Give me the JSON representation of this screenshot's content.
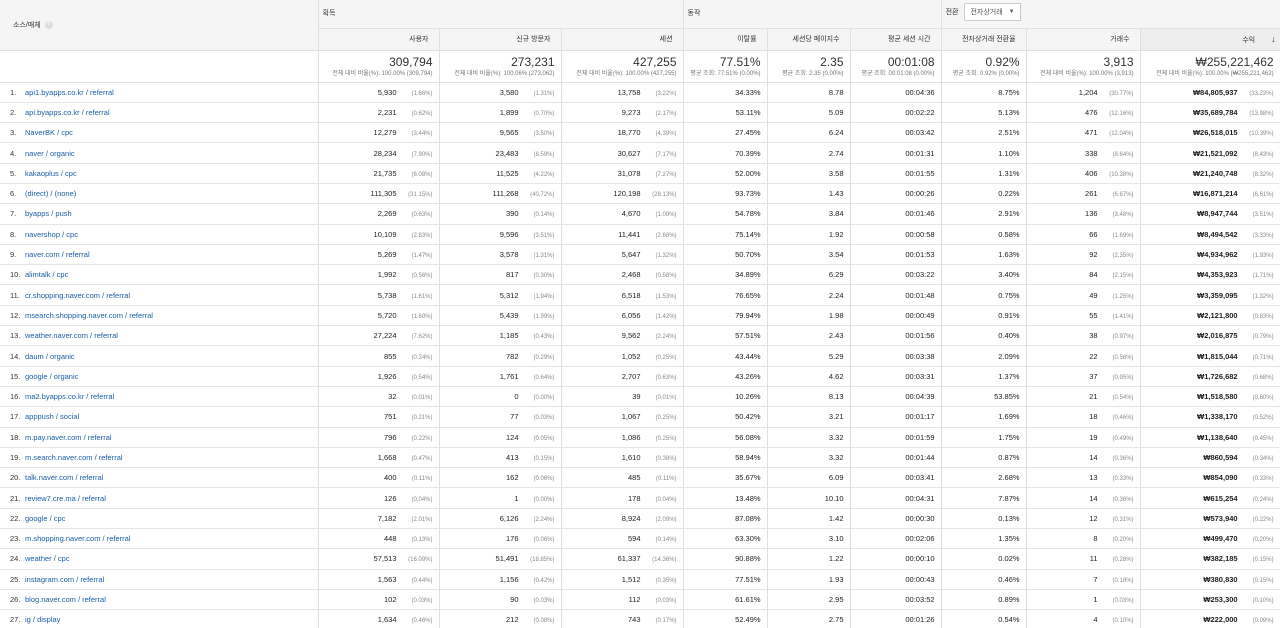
{
  "header": {
    "dimension_label": "소스/매체",
    "help_glyph": "?",
    "groups": {
      "acquisition": "획득",
      "behavior": "동작",
      "conversion": "전환"
    },
    "conversion_select": "전자상거래",
    "columns": [
      "사용자",
      "신규 방문자",
      "세션",
      "이탈률",
      "세션당 페이지수",
      "평균 세션 시간",
      "전자상거래 전환율",
      "거래수",
      "수익"
    ]
  },
  "totals": [
    {
      "value": "309,794",
      "sub": "전체 대비 비율(%): 100.00% (309,794)"
    },
    {
      "value": "273,231",
      "sub": "전체 대비 비율(%): 100.06% (273,062)"
    },
    {
      "value": "427,255",
      "sub": "전체 대비 비율(%): 100.00% (427,255)"
    },
    {
      "value": "77.51%",
      "sub": "평균 조회: 77.51% (0.00%)"
    },
    {
      "value": "2.35",
      "sub": "평균 조회: 2.35 (0.00%)"
    },
    {
      "value": "00:01:08",
      "sub": "평균 조회: 00:01:08 (0.00%)"
    },
    {
      "value": "0.92%",
      "sub": "평균 조회: 0.92% (0.00%)"
    },
    {
      "value": "3,913",
      "sub": "전체 대비 비율(%): 100.00% (3,913)"
    },
    {
      "value": "₩255,221,462",
      "sub": "전체 대비 비율(%): 100.00% (₩255,221,462)"
    }
  ],
  "rows": [
    {
      "idx": "1.",
      "source": "api1.byapps.co.kr / referral",
      "users": "5,930",
      "users_pct": "(1.66%)",
      "new_users": "3,580",
      "new_users_pct": "(1.31%)",
      "sessions": "13,758",
      "sessions_pct": "(3.22%)",
      "bounce": "34.33%",
      "pps": "8.78",
      "duration": "00:04:36",
      "conv": "8.75%",
      "trans": "1,204",
      "trans_pct": "(30.77%)",
      "revenue": "₩84,805,937",
      "revenue_pct": "(33.23%)"
    },
    {
      "idx": "2.",
      "source": "api.byapps.co.kr / referral",
      "users": "2,231",
      "users_pct": "(0.62%)",
      "new_users": "1,899",
      "new_users_pct": "(0.70%)",
      "sessions": "9,273",
      "sessions_pct": "(2.17%)",
      "bounce": "53.11%",
      "pps": "5.09",
      "duration": "00:02:22",
      "conv": "5.13%",
      "trans": "476",
      "trans_pct": "(12.16%)",
      "revenue": "₩35,689,784",
      "revenue_pct": "(13.98%)"
    },
    {
      "idx": "3.",
      "source": "NaverBK / cpc",
      "users": "12,279",
      "users_pct": "(3.44%)",
      "new_users": "9,565",
      "new_users_pct": "(3.50%)",
      "sessions": "18,770",
      "sessions_pct": "(4.39%)",
      "bounce": "27.45%",
      "pps": "6.24",
      "duration": "00:03:42",
      "conv": "2.51%",
      "trans": "471",
      "trans_pct": "(12.04%)",
      "revenue": "₩26,518,015",
      "revenue_pct": "(10.39%)"
    },
    {
      "idx": "4.",
      "source": "naver / organic",
      "users": "28,234",
      "users_pct": "(7.90%)",
      "new_users": "23,483",
      "new_users_pct": "(8.59%)",
      "sessions": "30,627",
      "sessions_pct": "(7.17%)",
      "bounce": "70.39%",
      "pps": "2.74",
      "duration": "00:01:31",
      "conv": "1.10%",
      "trans": "338",
      "trans_pct": "(8.64%)",
      "revenue": "₩21,521,092",
      "revenue_pct": "(8.43%)"
    },
    {
      "idx": "5.",
      "source": "kakaoplus / cpc",
      "users": "21,735",
      "users_pct": "(6.08%)",
      "new_users": "11,525",
      "new_users_pct": "(4.22%)",
      "sessions": "31,078",
      "sessions_pct": "(7.27%)",
      "bounce": "52.00%",
      "pps": "3.58",
      "duration": "00:01:55",
      "conv": "1.31%",
      "trans": "406",
      "trans_pct": "(10.38%)",
      "revenue": "₩21,240,748",
      "revenue_pct": "(8.32%)"
    },
    {
      "idx": "6.",
      "source": "(direct) / (none)",
      "users": "111,305",
      "users_pct": "(31.15%)",
      "new_users": "111,268",
      "new_users_pct": "(40.72%)",
      "sessions": "120,198",
      "sessions_pct": "(28.13%)",
      "bounce": "93.73%",
      "pps": "1.43",
      "duration": "00:00:26",
      "conv": "0.22%",
      "trans": "261",
      "trans_pct": "(6.67%)",
      "revenue": "₩16,871,214",
      "revenue_pct": "(6.61%)"
    },
    {
      "idx": "7.",
      "source": "byapps / push",
      "users": "2,269",
      "users_pct": "(0.63%)",
      "new_users": "390",
      "new_users_pct": "(0.14%)",
      "sessions": "4,670",
      "sessions_pct": "(1.09%)",
      "bounce": "54.78%",
      "pps": "3.84",
      "duration": "00:01:46",
      "conv": "2.91%",
      "trans": "136",
      "trans_pct": "(3.48%)",
      "revenue": "₩8,947,744",
      "revenue_pct": "(3.51%)"
    },
    {
      "idx": "8.",
      "source": "navershop / cpc",
      "users": "10,109",
      "users_pct": "(2.83%)",
      "new_users": "9,596",
      "new_users_pct": "(3.51%)",
      "sessions": "11,441",
      "sessions_pct": "(2.68%)",
      "bounce": "75.14%",
      "pps": "1.92",
      "duration": "00:00:58",
      "conv": "0.58%",
      "trans": "66",
      "trans_pct": "(1.69%)",
      "revenue": "₩8,494,542",
      "revenue_pct": "(3.33%)"
    },
    {
      "idx": "9.",
      "source": "naver.com / referral",
      "users": "5,269",
      "users_pct": "(1.47%)",
      "new_users": "3,578",
      "new_users_pct": "(1.31%)",
      "sessions": "5,647",
      "sessions_pct": "(1.32%)",
      "bounce": "50.70%",
      "pps": "3.54",
      "duration": "00:01:53",
      "conv": "1.63%",
      "trans": "92",
      "trans_pct": "(2.35%)",
      "revenue": "₩4,934,962",
      "revenue_pct": "(1.93%)"
    },
    {
      "idx": "10.",
      "source": "alimtalk / cpc",
      "users": "1,992",
      "users_pct": "(0.56%)",
      "new_users": "817",
      "new_users_pct": "(0.30%)",
      "sessions": "2,468",
      "sessions_pct": "(0.58%)",
      "bounce": "34.89%",
      "pps": "6.29",
      "duration": "00:03:22",
      "conv": "3.40%",
      "trans": "84",
      "trans_pct": "(2.15%)",
      "revenue": "₩4,353,923",
      "revenue_pct": "(1.71%)"
    },
    {
      "idx": "11.",
      "source": "cr.shopping.naver.com / referral",
      "users": "5,738",
      "users_pct": "(1.61%)",
      "new_users": "5,312",
      "new_users_pct": "(1.94%)",
      "sessions": "6,518",
      "sessions_pct": "(1.53%)",
      "bounce": "76.65%",
      "pps": "2.24",
      "duration": "00:01:48",
      "conv": "0.75%",
      "trans": "49",
      "trans_pct": "(1.25%)",
      "revenue": "₩3,359,095",
      "revenue_pct": "(1.32%)"
    },
    {
      "idx": "12.",
      "source": "msearch.shopping.naver.com / referral",
      "users": "5,720",
      "users_pct": "(1.60%)",
      "new_users": "5,439",
      "new_users_pct": "(1.99%)",
      "sessions": "6,056",
      "sessions_pct": "(1.42%)",
      "bounce": "79.94%",
      "pps": "1.98",
      "duration": "00:00:49",
      "conv": "0.91%",
      "trans": "55",
      "trans_pct": "(1.41%)",
      "revenue": "₩2,121,800",
      "revenue_pct": "(0.83%)"
    },
    {
      "idx": "13.",
      "source": "weather.naver.com / referral",
      "users": "27,224",
      "users_pct": "(7.62%)",
      "new_users": "1,185",
      "new_users_pct": "(0.43%)",
      "sessions": "9,562",
      "sessions_pct": "(2.24%)",
      "bounce": "57.51%",
      "pps": "2.43",
      "duration": "00:01:56",
      "conv": "0.40%",
      "trans": "38",
      "trans_pct": "(0.97%)",
      "revenue": "₩2,016,875",
      "revenue_pct": "(0.79%)"
    },
    {
      "idx": "14.",
      "source": "daum / organic",
      "users": "855",
      "users_pct": "(0.24%)",
      "new_users": "782",
      "new_users_pct": "(0.29%)",
      "sessions": "1,052",
      "sessions_pct": "(0.25%)",
      "bounce": "43.44%",
      "pps": "5.29",
      "duration": "00:03:38",
      "conv": "2.09%",
      "trans": "22",
      "trans_pct": "(0.56%)",
      "revenue": "₩1,815,044",
      "revenue_pct": "(0.71%)"
    },
    {
      "idx": "15.",
      "source": "google / organic",
      "users": "1,926",
      "users_pct": "(0.54%)",
      "new_users": "1,761",
      "new_users_pct": "(0.64%)",
      "sessions": "2,707",
      "sessions_pct": "(0.63%)",
      "bounce": "43.26%",
      "pps": "4.62",
      "duration": "00:03:31",
      "conv": "1.37%",
      "trans": "37",
      "trans_pct": "(0.95%)",
      "revenue": "₩1,726,682",
      "revenue_pct": "(0.68%)"
    },
    {
      "idx": "16.",
      "source": "ma2.byapps.co.kr / referral",
      "users": "32",
      "users_pct": "(0.01%)",
      "new_users": "0",
      "new_users_pct": "(0.00%)",
      "sessions": "39",
      "sessions_pct": "(0.01%)",
      "bounce": "10.26%",
      "pps": "8.13",
      "duration": "00:04:39",
      "conv": "53.85%",
      "trans": "21",
      "trans_pct": "(0.54%)",
      "revenue": "₩1,518,580",
      "revenue_pct": "(0.60%)"
    },
    {
      "idx": "17.",
      "source": "apppush / social",
      "users": "751",
      "users_pct": "(0.21%)",
      "new_users": "77",
      "new_users_pct": "(0.03%)",
      "sessions": "1,067",
      "sessions_pct": "(0.25%)",
      "bounce": "50.42%",
      "pps": "3.21",
      "duration": "00:01:17",
      "conv": "1.69%",
      "trans": "18",
      "trans_pct": "(0.46%)",
      "revenue": "₩1,338,170",
      "revenue_pct": "(0.52%)"
    },
    {
      "idx": "18.",
      "source": "m.pay.naver.com / referral",
      "users": "796",
      "users_pct": "(0.22%)",
      "new_users": "124",
      "new_users_pct": "(0.05%)",
      "sessions": "1,086",
      "sessions_pct": "(0.25%)",
      "bounce": "56.08%",
      "pps": "3.32",
      "duration": "00:01:59",
      "conv": "1.75%",
      "trans": "19",
      "trans_pct": "(0.49%)",
      "revenue": "₩1,138,640",
      "revenue_pct": "(0.45%)"
    },
    {
      "idx": "19.",
      "source": "m.search.naver.com / referral",
      "users": "1,668",
      "users_pct": "(0.47%)",
      "new_users": "413",
      "new_users_pct": "(0.15%)",
      "sessions": "1,610",
      "sessions_pct": "(0.38%)",
      "bounce": "58.94%",
      "pps": "3.32",
      "duration": "00:01:44",
      "conv": "0.87%",
      "trans": "14",
      "trans_pct": "(0.36%)",
      "revenue": "₩860,594",
      "revenue_pct": "(0.34%)"
    },
    {
      "idx": "20.",
      "source": "talk.naver.com / referral",
      "users": "400",
      "users_pct": "(0.11%)",
      "new_users": "162",
      "new_users_pct": "(0.06%)",
      "sessions": "485",
      "sessions_pct": "(0.11%)",
      "bounce": "35.67%",
      "pps": "6.09",
      "duration": "00:03:41",
      "conv": "2.68%",
      "trans": "13",
      "trans_pct": "(0.33%)",
      "revenue": "₩854,090",
      "revenue_pct": "(0.33%)"
    },
    {
      "idx": "21.",
      "source": "review7.cre.ma / referral",
      "users": "126",
      "users_pct": "(0.04%)",
      "new_users": "1",
      "new_users_pct": "(0.00%)",
      "sessions": "178",
      "sessions_pct": "(0.04%)",
      "bounce": "13.48%",
      "pps": "10.10",
      "duration": "00:04:31",
      "conv": "7.87%",
      "trans": "14",
      "trans_pct": "(0.36%)",
      "revenue": "₩615,254",
      "revenue_pct": "(0.24%)"
    },
    {
      "idx": "22.",
      "source": "google / cpc",
      "users": "7,182",
      "users_pct": "(2.01%)",
      "new_users": "6,126",
      "new_users_pct": "(2.24%)",
      "sessions": "8,924",
      "sessions_pct": "(2.09%)",
      "bounce": "87.08%",
      "pps": "1.42",
      "duration": "00:00:30",
      "conv": "0.13%",
      "trans": "12",
      "trans_pct": "(0.31%)",
      "revenue": "₩573,940",
      "revenue_pct": "(0.22%)"
    },
    {
      "idx": "23.",
      "source": "m.shopping.naver.com / referral",
      "users": "448",
      "users_pct": "(0.13%)",
      "new_users": "176",
      "new_users_pct": "(0.06%)",
      "sessions": "594",
      "sessions_pct": "(0.14%)",
      "bounce": "63.30%",
      "pps": "3.10",
      "duration": "00:02:06",
      "conv": "1.35%",
      "trans": "8",
      "trans_pct": "(0.20%)",
      "revenue": "₩499,470",
      "revenue_pct": "(0.20%)"
    },
    {
      "idx": "24.",
      "source": "weather / cpc",
      "users": "57,513",
      "users_pct": "(16.09%)",
      "new_users": "51,491",
      "new_users_pct": "(18.85%)",
      "sessions": "61,337",
      "sessions_pct": "(14.36%)",
      "bounce": "90.88%",
      "pps": "1.22",
      "duration": "00:00:10",
      "conv": "0.02%",
      "trans": "11",
      "trans_pct": "(0.28%)",
      "revenue": "₩382,185",
      "revenue_pct": "(0.15%)"
    },
    {
      "idx": "25.",
      "source": "instagram.com / referral",
      "users": "1,563",
      "users_pct": "(0.44%)",
      "new_users": "1,156",
      "new_users_pct": "(0.42%)",
      "sessions": "1,512",
      "sessions_pct": "(0.35%)",
      "bounce": "77.51%",
      "pps": "1.93",
      "duration": "00:00:43",
      "conv": "0.46%",
      "trans": "7",
      "trans_pct": "(0.18%)",
      "revenue": "₩380,830",
      "revenue_pct": "(0.15%)"
    },
    {
      "idx": "26.",
      "source": "blog.naver.com / referral",
      "users": "102",
      "users_pct": "(0.03%)",
      "new_users": "90",
      "new_users_pct": "(0.03%)",
      "sessions": "112",
      "sessions_pct": "(0.03%)",
      "bounce": "61.61%",
      "pps": "2.95",
      "duration": "00:03:52",
      "conv": "0.89%",
      "trans": "1",
      "trans_pct": "(0.03%)",
      "revenue": "₩253,300",
      "revenue_pct": "(0.10%)"
    },
    {
      "idx": "27.",
      "source": "ig / display",
      "users": "1,634",
      "users_pct": "(0.46%)",
      "new_users": "212",
      "new_users_pct": "(0.08%)",
      "sessions": "743",
      "sessions_pct": "(0.17%)",
      "bounce": "52.49%",
      "pps": "2.75",
      "duration": "00:01:26",
      "conv": "0.54%",
      "trans": "4",
      "trans_pct": "(0.10%)",
      "revenue": "₩222,000",
      "revenue_pct": "(0.09%)"
    }
  ]
}
